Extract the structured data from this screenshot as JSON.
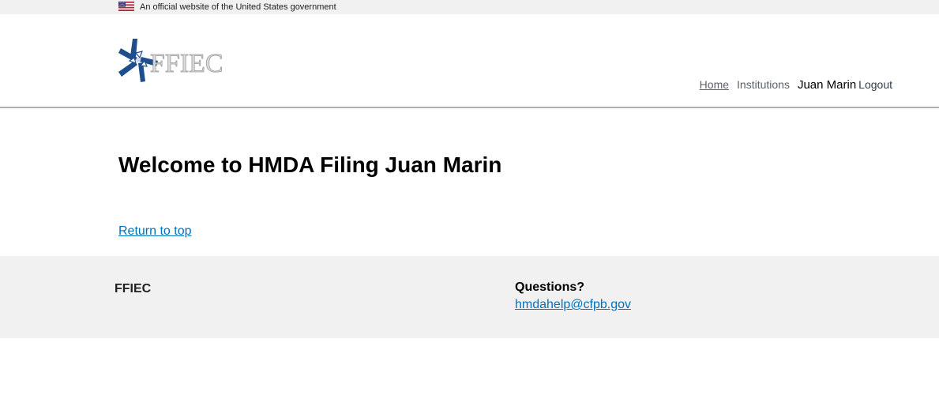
{
  "banner": {
    "text": "An official website of the United States government",
    "flag_icon": "us-flag-icon"
  },
  "header": {
    "logo_text": "FFIEC",
    "logo_icon": "ffiec-star-logo-icon",
    "nav": {
      "home": "Home",
      "institutions": "Institutions",
      "user_name": "Juan Marin",
      "logout": "Logout"
    }
  },
  "main": {
    "title": "Welcome to HMDA Filing Juan Marin",
    "return_to_top": "Return to top"
  },
  "footer": {
    "brand": "FFIEC",
    "questions_heading": "Questions?",
    "help_email": "hmdahelp@cfpb.gov"
  },
  "colors": {
    "link": "#0071bc",
    "banner_bg": "#f1f1f1",
    "footer_bg": "#f1f1f1",
    "header_border": "#aeb0b5",
    "logo_blue": "#1f4e8c"
  }
}
